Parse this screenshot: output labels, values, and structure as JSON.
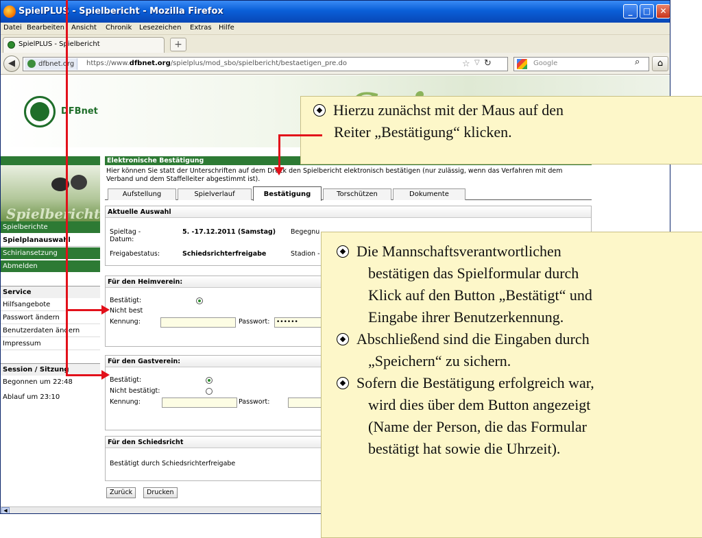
{
  "browser": {
    "title": "SpielPLUS - Spielbericht - Mozilla Firefox",
    "menu": [
      "Datei",
      "Bearbeiten",
      "Ansicht",
      "Chronik",
      "Lesezeichen",
      "Extras",
      "Hilfe"
    ],
    "tab_label": "SpielPLUS - Spielbericht",
    "new_tab": "+",
    "site_badge": "dfbnet.org",
    "url_prefix": "https://www.",
    "url_domain": "dfbnet.org",
    "url_path": "/spielplus/mod_sbo/spielbericht/bestaetigen_pre.do",
    "search_placeholder": "Google"
  },
  "banner": {
    "logo_text": "DFBnet",
    "wordmark": "Spie"
  },
  "sidebar": {
    "logo_text": "Spielbericht",
    "nav": [
      "Spielberichte",
      "Spielplanauswahl",
      "Schiriansetzung",
      "Abmelden"
    ],
    "service_title": "Service",
    "service_items": [
      "Hilfsangebote",
      "Passwort ändern",
      "Benutzerdaten ändern",
      "Impressum"
    ],
    "session_title": "Session / Sitzung",
    "session_items": [
      "Begonnen um 22:48",
      "Ablauf um 23:10"
    ]
  },
  "main": {
    "header": "Elektronische Bestätigung",
    "intro": "Hier können Sie statt der Unterschriften auf dem Druck den Spielbericht elektronisch bestätigen (nur zulässig, wenn das Verfahren mit dem Verband und dem Staffelleiter abgestimmt ist).",
    "tabs": [
      "Aufstellung",
      "Spielverlauf",
      "Bestätigung",
      "Torschützen",
      "Dokumente"
    ],
    "auswahl": {
      "title": "Aktuelle Auswahl",
      "spieltag_label": "Spieltag - Datum:",
      "spieltag_value": "5. -17.12.2011 (Samstag)",
      "begegnung_label": "Begegnu",
      "freigabe_label": "Freigabestatus:",
      "freigabe_value": "Schiedsrichterfreigabe",
      "stadion_label": "Stadion -"
    },
    "heim": {
      "title": "Für den Heimverein:",
      "bestaetigt": "Bestätigt:",
      "nicht": "Nicht best",
      "kennung": "Kennung:",
      "passwort": "Passwort:",
      "passwort_value": "••••••"
    },
    "gast": {
      "title": "Für den Gastverein:",
      "bestaetigt": "Bestätigt:",
      "nicht": "Nicht bestätigt:",
      "kennung": "Kennung:",
      "passwort": "Passwort:"
    },
    "schiri": {
      "title": "Für den Schiedsricht",
      "text": "Bestätigt durch Schiedsrichterfreigabe"
    },
    "buttons": [
      "Zurück",
      "Drucken"
    ]
  },
  "notes": {
    "top": [
      "Hierzu zunächst mit der Maus auf den",
      "Reiter „Bestätigung“ klicken."
    ],
    "bottom": [
      [
        "Die Mannschaftsverantwortlichen",
        "bestätigen das Spielformular durch",
        "Klick auf den Button „Bestätigt“ und",
        "Eingabe ihrer Benutzerkennung."
      ],
      [
        "Abschließend sind die Eingaben durch",
        "„Speichern“ zu sichern."
      ],
      [
        "Sofern die Bestätigung erfolgreich war,",
        "wird dies über dem Button angezeigt",
        "(Name der Person, die das Formular",
        "bestätigt hat sowie die Uhrzeit)."
      ]
    ]
  },
  "colors": {
    "dfb_green": "#2d7a34",
    "annotation_red": "#e2101a",
    "note_bg": "#fdf7c9"
  }
}
